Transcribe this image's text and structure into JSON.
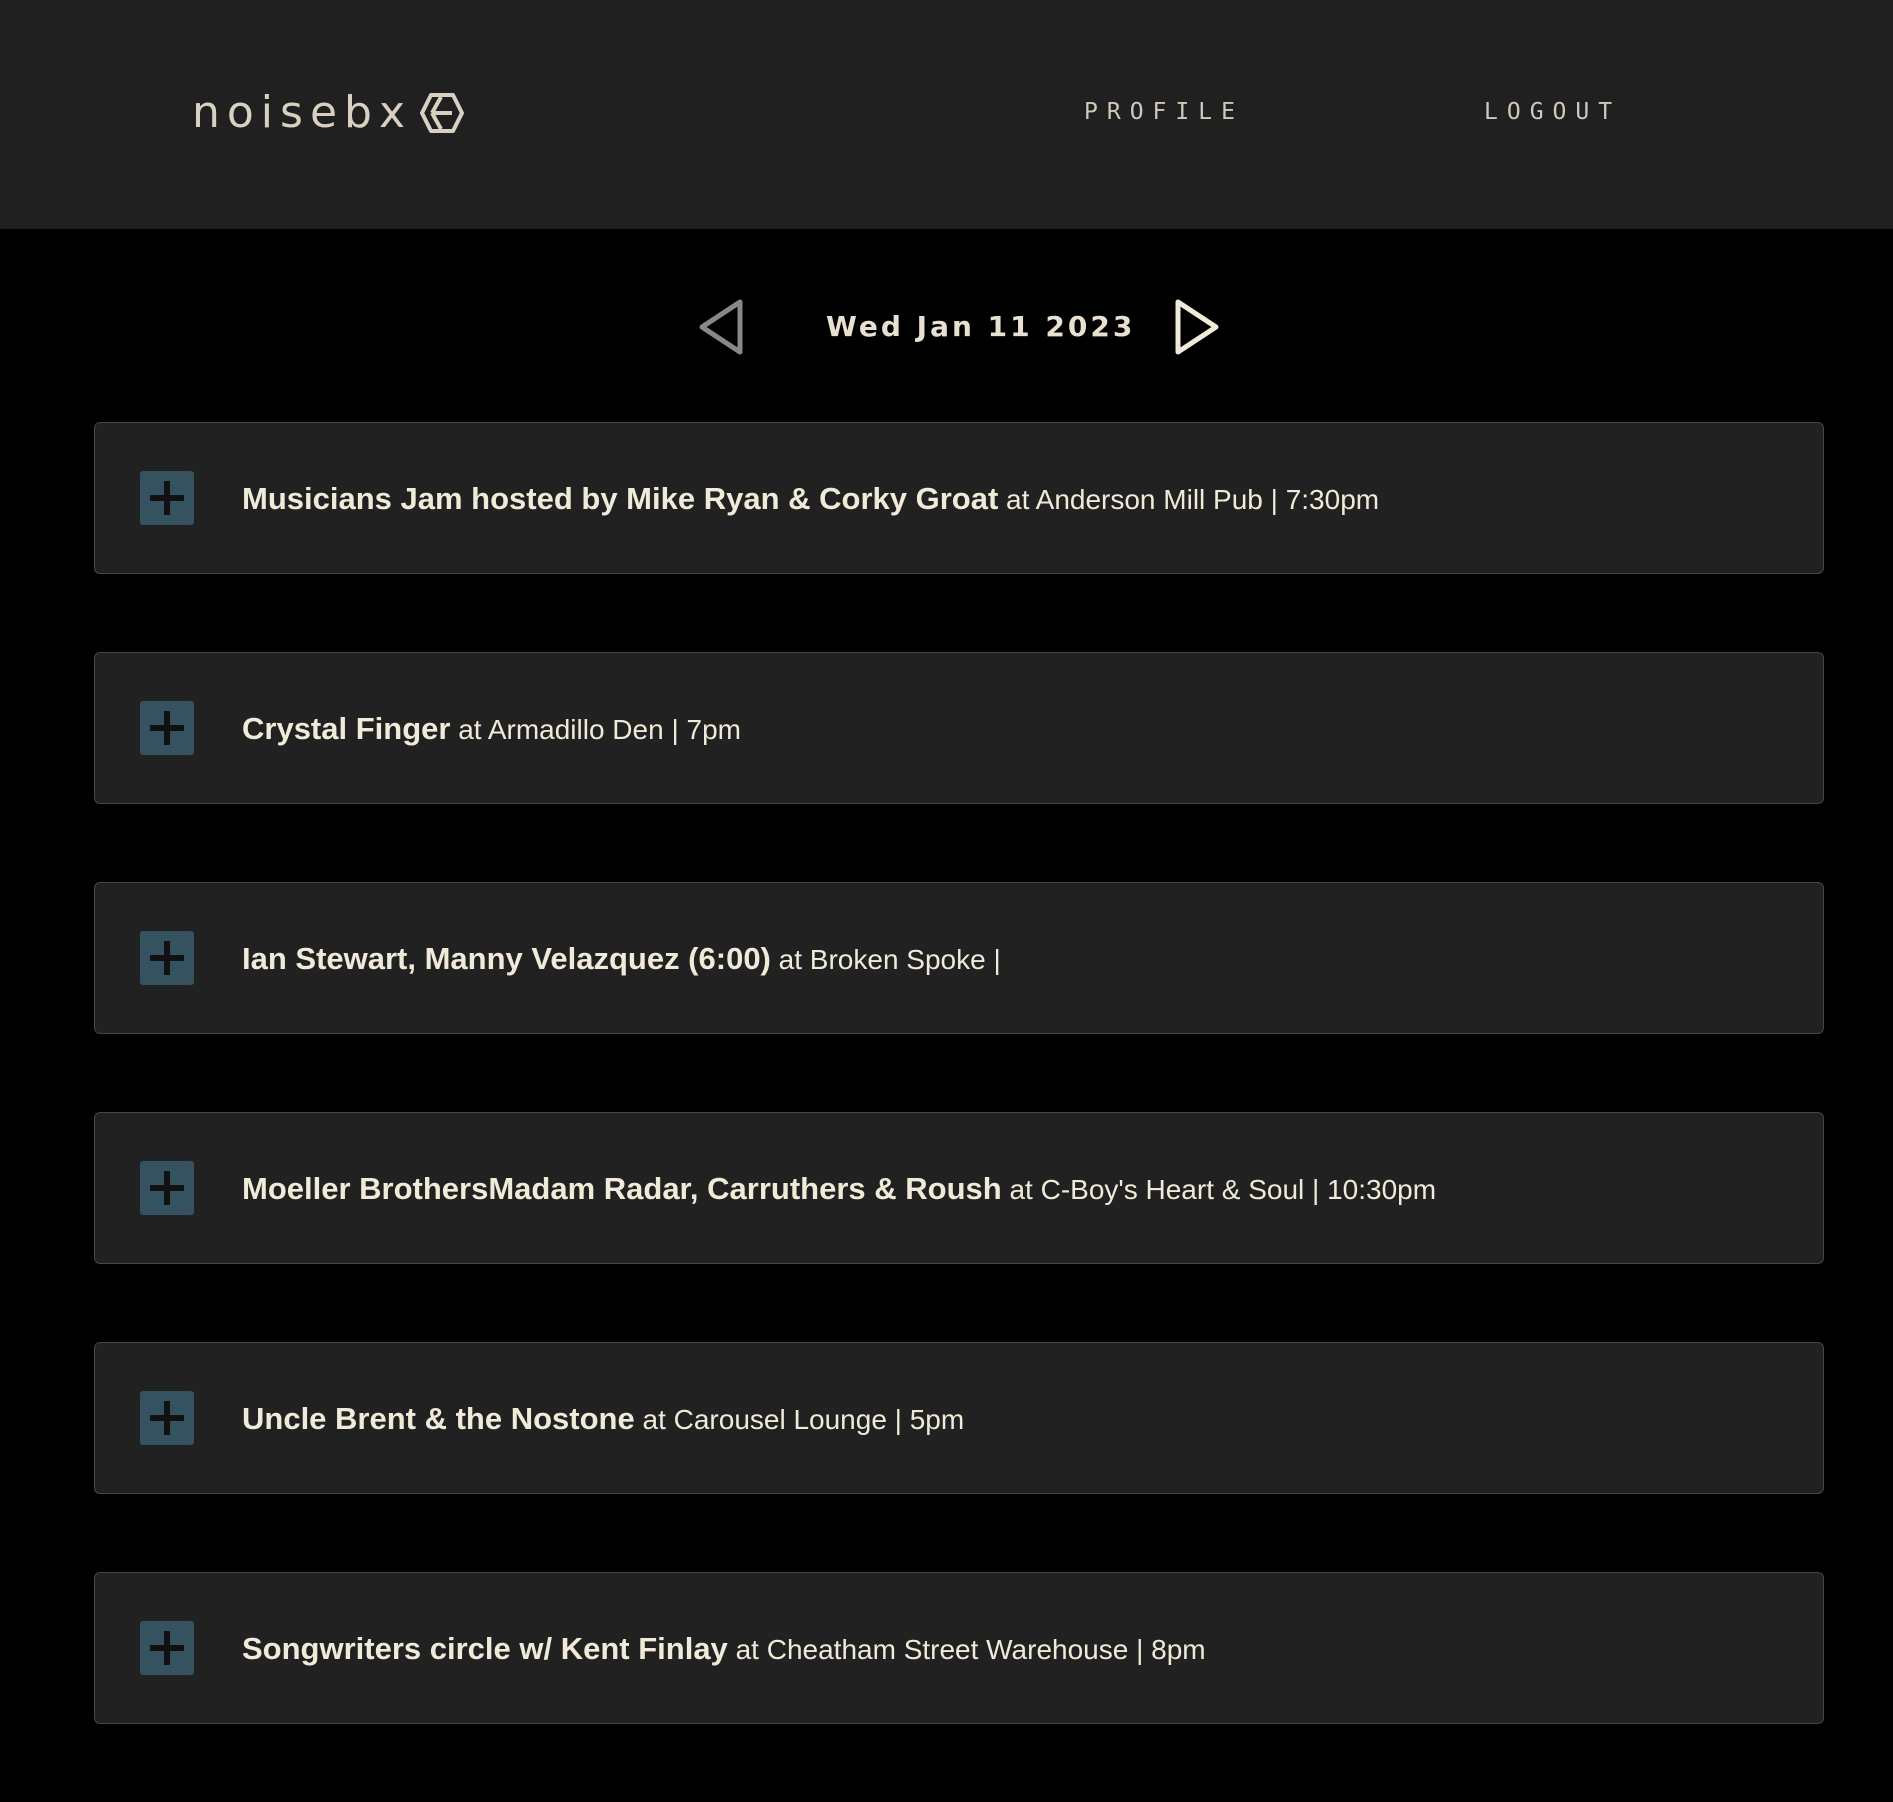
{
  "header": {
    "logo_text": "noisebx",
    "nav": {
      "profile_label": "PROFILE",
      "logout_label": "LOGOUT"
    }
  },
  "date_nav": {
    "prev_icon": "triangle-left-icon",
    "next_icon": "triangle-right-icon",
    "date_label": "Wed Jan 11 2023"
  },
  "events": [
    {
      "title": "Musicians Jam hosted by Mike Ryan & Corky Groat",
      "detail": " at Anderson Mill Pub | 7:30pm"
    },
    {
      "title": "Crystal Finger",
      "detail": " at Armadillo Den | 7pm"
    },
    {
      "title": "Ian Stewart, Manny Velazquez (6:00)",
      "detail": " at Broken Spoke |"
    },
    {
      "title": "Moeller BrothersMadam Radar, Carruthers & Roush",
      "detail": " at C-Boy's Heart & Soul | 10:30pm"
    },
    {
      "title": "Uncle Brent & the Nostone",
      "detail": " at Carousel Lounge | 5pm"
    },
    {
      "title": "Songwriters circle w/ Kent Finlay",
      "detail": " at Cheatham Street Warehouse | 8pm"
    }
  ],
  "colors": {
    "page_background": "#000000",
    "header_background": "#202020",
    "card_background": "#212121",
    "card_border": "#3a4a52",
    "expand_button": "#34525f",
    "text": "#f0ead8"
  }
}
